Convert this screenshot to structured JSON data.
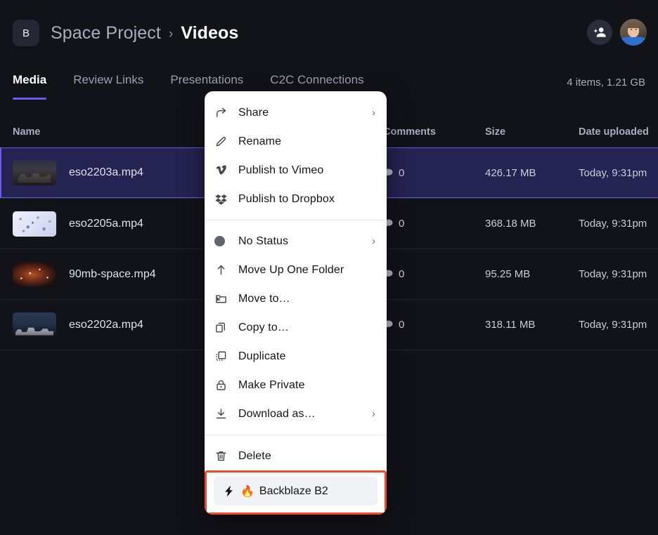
{
  "header": {
    "project_badge": "B",
    "breadcrumb_parent": "Space Project",
    "breadcrumb_sep": "›",
    "breadcrumb_current": "Videos",
    "add_person_icon": "add-person-icon",
    "avatar_icon": "user-avatar"
  },
  "tabs": [
    {
      "label": "Media",
      "active": true
    },
    {
      "label": "Review Links",
      "active": false
    },
    {
      "label": "Presentations",
      "active": false
    },
    {
      "label": "C2C Connections",
      "active": false
    }
  ],
  "items_meta": "4 items, 1.21 GB",
  "table": {
    "columns": [
      "Name",
      "Comments",
      "Size",
      "Date uploaded"
    ],
    "rows": [
      {
        "name": "eso2203a.mp4",
        "comments": "0",
        "size": "426.17 MB",
        "date": "Today, 9:31pm",
        "selected": true
      },
      {
        "name": "eso2205a.mp4",
        "comments": "0",
        "size": "368.18 MB",
        "date": "Today, 9:31pm",
        "selected": false
      },
      {
        "name": "90mb-space.mp4",
        "comments": "0",
        "size": "95.25 MB",
        "date": "Today, 9:31pm",
        "selected": false
      },
      {
        "name": "eso2202a.mp4",
        "comments": "0",
        "size": "318.11 MB",
        "date": "Today, 9:31pm",
        "selected": false
      }
    ]
  },
  "context_menu": {
    "group1": [
      {
        "label": "Share",
        "icon": "share-arrow-icon",
        "submenu": "›"
      },
      {
        "label": "Rename",
        "icon": "pencil-icon",
        "submenu": ""
      },
      {
        "label": "Publish to Vimeo",
        "icon": "vimeo-icon",
        "submenu": ""
      },
      {
        "label": "Publish to Dropbox",
        "icon": "dropbox-icon",
        "submenu": ""
      }
    ],
    "group2": [
      {
        "label": "No Status",
        "icon": "status-dot-icon",
        "submenu": "›"
      },
      {
        "label": "Move Up One Folder",
        "icon": "arrow-up-icon",
        "submenu": ""
      },
      {
        "label": "Move to…",
        "icon": "move-folder-icon",
        "submenu": ""
      },
      {
        "label": "Copy to…",
        "icon": "copy-icon",
        "submenu": ""
      },
      {
        "label": "Duplicate",
        "icon": "duplicate-icon",
        "submenu": ""
      },
      {
        "label": "Make Private",
        "icon": "lock-icon",
        "submenu": ""
      },
      {
        "label": "Download as…",
        "icon": "download-icon",
        "submenu": "›"
      }
    ],
    "group3": [
      {
        "label": "Delete",
        "icon": "trash-icon",
        "submenu": ""
      }
    ],
    "backblaze": {
      "label": "Backblaze B2",
      "emoji": "🔥",
      "icon": "lightning-bolt-icon"
    }
  },
  "colors": {
    "app_bg": "#121219",
    "accent_purple": "#6a5cf0",
    "selected_row_bg": "#252352",
    "menu_bg": "#ffffff",
    "highlight_border": "#ef4a20",
    "badge_bg": "#252734"
  }
}
